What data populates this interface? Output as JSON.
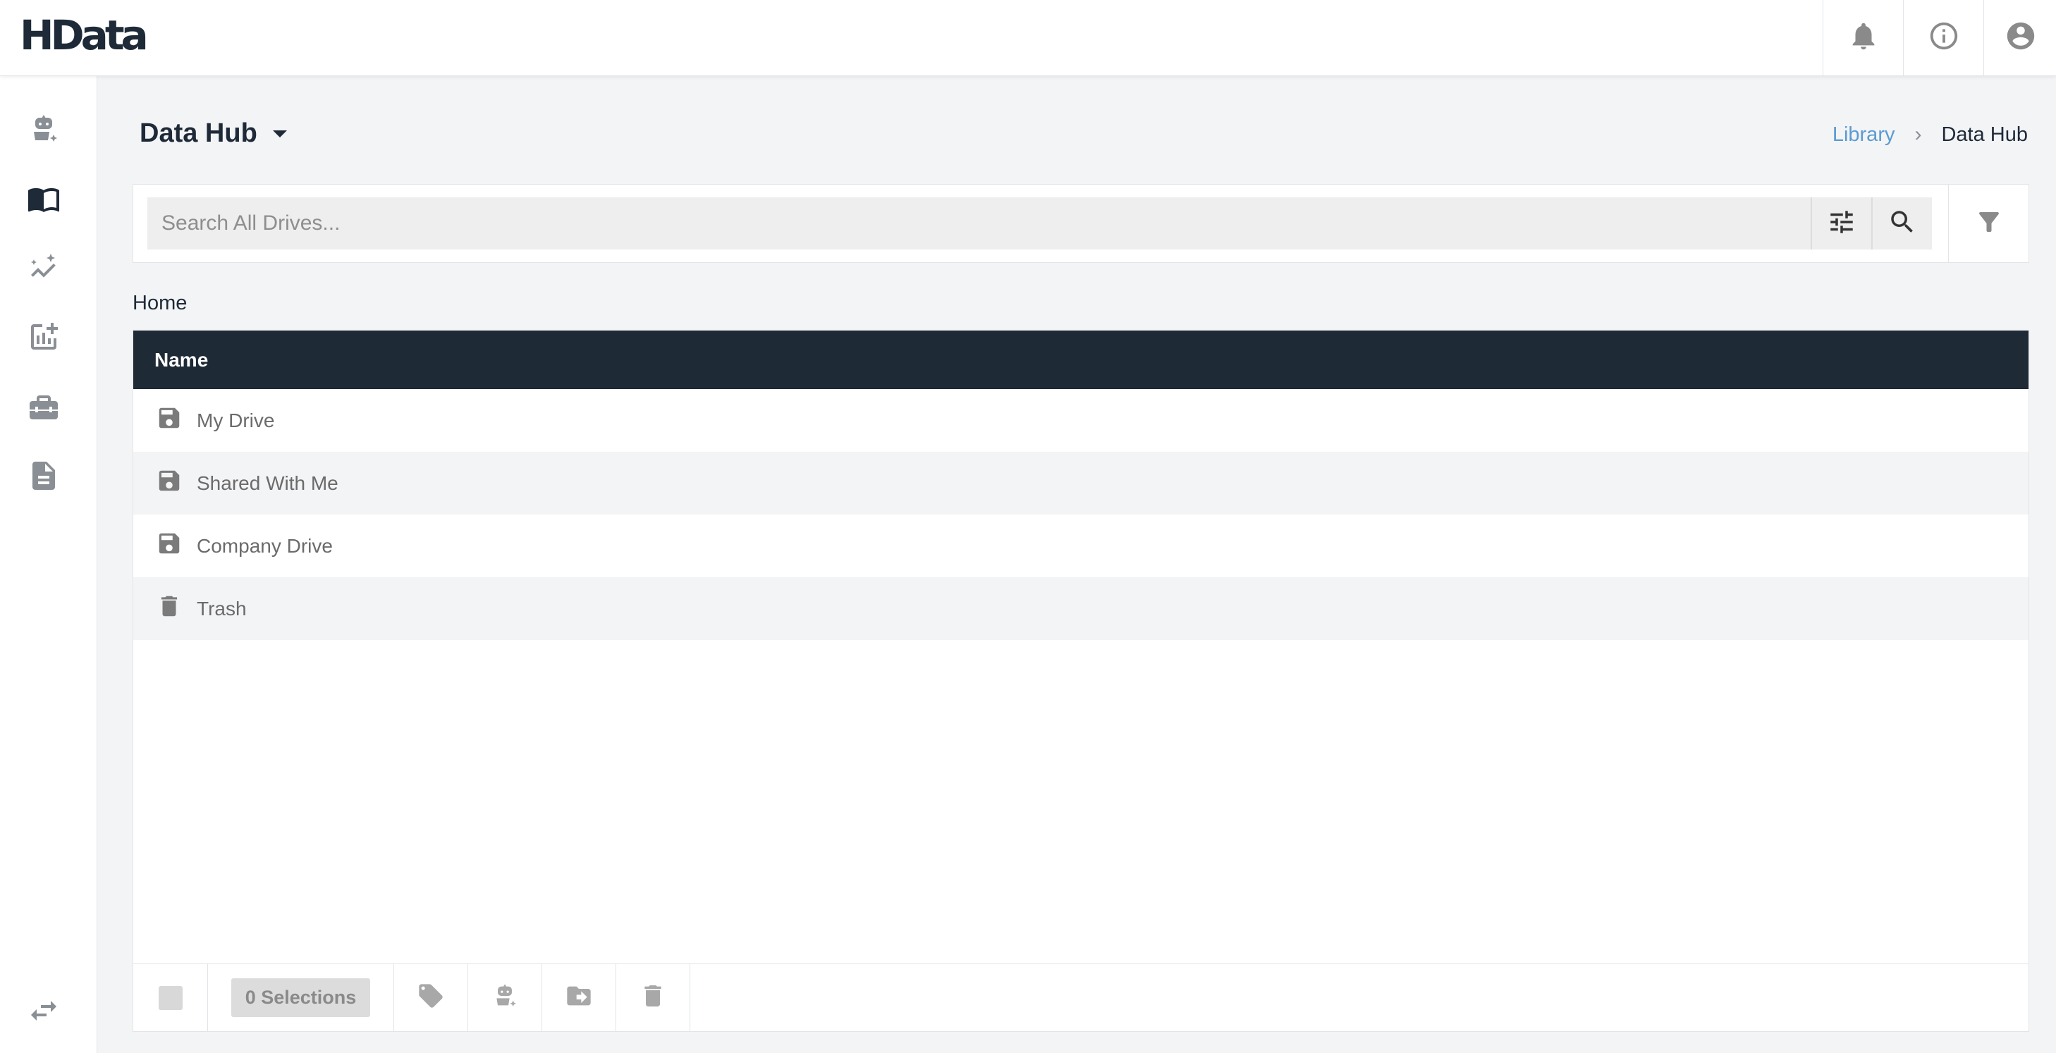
{
  "app": {
    "logo_text": "HData"
  },
  "topbar": {
    "icons": [
      "bell-icon",
      "info-icon",
      "account-icon"
    ]
  },
  "sidebar": {
    "items": [
      {
        "icon": "robot-assistant-icon",
        "active": false
      },
      {
        "icon": "library-book-icon",
        "active": true
      },
      {
        "icon": "analytics-sparkle-icon",
        "active": false
      },
      {
        "icon": "add-chart-icon",
        "active": false
      },
      {
        "icon": "toolbox-icon",
        "active": false
      },
      {
        "icon": "document-icon",
        "active": false
      }
    ],
    "bottom_icon": "swap-arrows-icon"
  },
  "header": {
    "title": "Data Hub"
  },
  "breadcrumb": {
    "link": "Library",
    "separator": "›",
    "current": "Data Hub"
  },
  "search": {
    "placeholder": "Search All Drives...",
    "value": ""
  },
  "location": {
    "label": "Home"
  },
  "table": {
    "header": "Name",
    "rows": [
      {
        "name": "My Drive",
        "icon": "save-drive-icon"
      },
      {
        "name": "Shared With Me",
        "icon": "save-drive-icon"
      },
      {
        "name": "Company Drive",
        "icon": "save-drive-icon"
      },
      {
        "name": "Trash",
        "icon": "trash-icon"
      }
    ]
  },
  "toolbar": {
    "selections_label": "0 Selections"
  },
  "colors": {
    "header_bg": "#1f2a37",
    "link": "#5b9bd1",
    "page_bg": "#f3f4f6"
  }
}
